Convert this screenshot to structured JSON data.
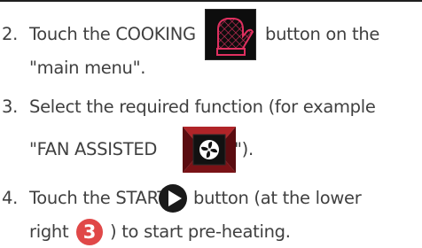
{
  "steps": [
    {
      "number": "2.",
      "before": "Touch the COOKING",
      "after": "button on the",
      "continuation": "\"main menu\"."
    },
    {
      "number": "3.",
      "line1": "Select the required function (for example",
      "before": "\"FAN ASSISTED",
      "after": "\")."
    },
    {
      "number": "4.",
      "before": "Touch the START",
      "after": "button (at the lower",
      "line2_before": "right",
      "badge": "3",
      "line2_after": ") to start pre-heating."
    }
  ],
  "icons": {
    "cooking": "oven-glove-icon",
    "fan": "fan-assisted-icon",
    "start": "play-icon"
  },
  "colors": {
    "text": "#404040",
    "cooking_icon_accent": "#e03060",
    "fan_icon_accent": "#c0282c",
    "badge": "#e04848"
  }
}
